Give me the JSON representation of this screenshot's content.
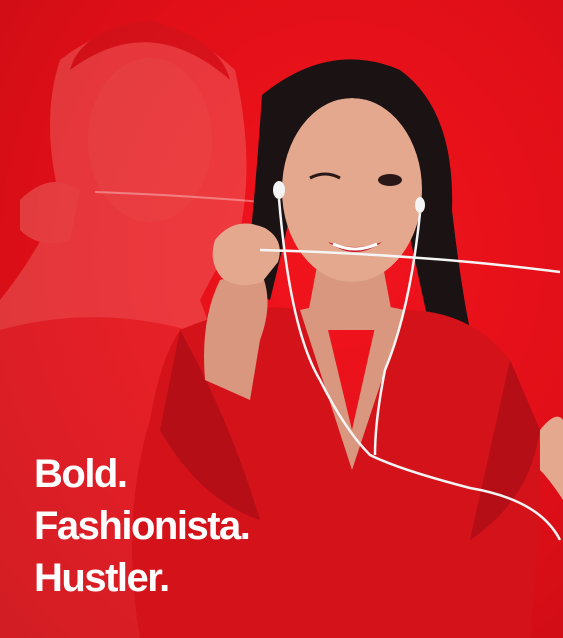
{
  "headline": {
    "line1": "Bold.",
    "line2": "Fashionista.",
    "line3": "Hustler."
  },
  "colors": {
    "background": "#e8121b",
    "text": "#ffffff",
    "dress": "#d4121a",
    "hair": "#1b1214",
    "skin": "#e3a88e",
    "earphone_cable": "#f4f4f4"
  }
}
